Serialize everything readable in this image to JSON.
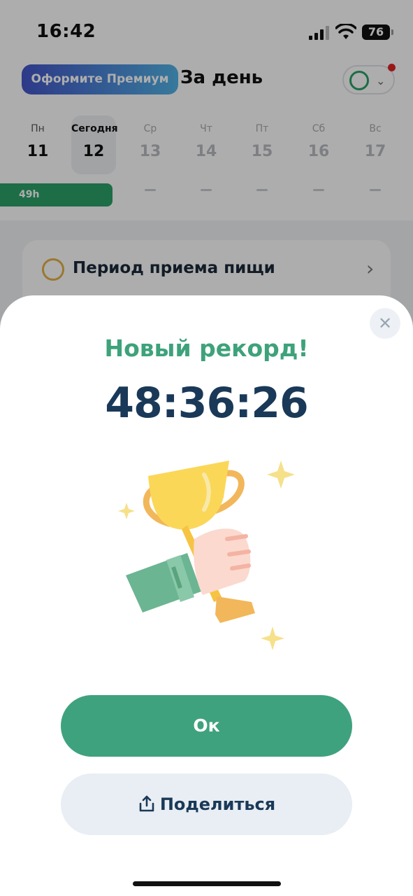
{
  "status_bar": {
    "time": "16:42",
    "battery": "76"
  },
  "header": {
    "premium_label": "Оформите Премиум",
    "title": "За день"
  },
  "week": [
    {
      "name": "Пн",
      "num": "11"
    },
    {
      "name": "Сегодня",
      "num": "12"
    },
    {
      "name": "Ср",
      "num": "13"
    },
    {
      "name": "Чт",
      "num": "14"
    },
    {
      "name": "Пт",
      "num": "15"
    },
    {
      "name": "Сб",
      "num": "16"
    },
    {
      "name": "Вс",
      "num": "17"
    }
  ],
  "fast_bar_label": "49h",
  "meal_card": {
    "title": "Период приема пищи"
  },
  "modal": {
    "title": "Новый рекорд!",
    "time": "48:36:26",
    "ok_label": "Ок",
    "share_label": "Поделиться"
  },
  "colors": {
    "accent_green": "#3fa27e",
    "dark_navy": "#1a3958",
    "premium_start": "#4456c9",
    "premium_end": "#52b3e6"
  },
  "icons": [
    "fork-icon",
    "chevron-down-icon",
    "chevron-right-icon",
    "close-icon",
    "trophy-illustration",
    "share-icon"
  ]
}
